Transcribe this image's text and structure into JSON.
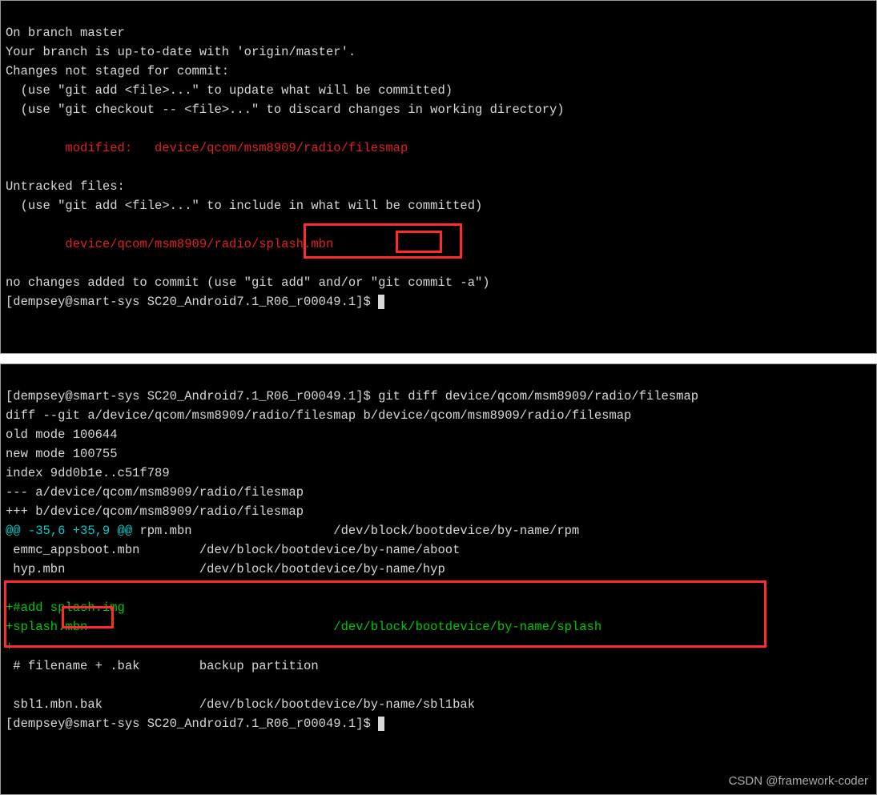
{
  "top": {
    "l1": "On branch master",
    "l2": "Your branch is up-to-date with 'origin/master'.",
    "l3": "Changes not staged for commit:",
    "l4": "  (use \"git add <file>...\" to update what will be committed)",
    "l5": "  (use \"git checkout -- <file>...\" to discard changes in working directory)",
    "l6": "",
    "l7": "        modified:   device/qcom/msm8909/radio/filesmap",
    "l8": "",
    "l9": "Untracked files:",
    "l10": "  (use \"git add <file>...\" to include in what will be committed)",
    "l11": "",
    "l12": "        device/qcom/msm8909/radio/splash.mbn",
    "l13": "",
    "l14": "no changes added to commit (use \"git add\" and/or \"git commit -a\")",
    "prompt": "[dempsey@smart-sys SC20_Android7.1_R06_r00049.1]$ "
  },
  "bottom": {
    "prompt1": "[dempsey@smart-sys SC20_Android7.1_R06_r00049.1]$ ",
    "cmd1": "git diff device/qcom/msm8909/radio/filesmap",
    "l2": "diff --git a/device/qcom/msm8909/radio/filesmap b/device/qcom/msm8909/radio/filesmap",
    "l3": "old mode 100644",
    "l4": "new mode 100755",
    "l5": "index 9dd0b1e..c51f789",
    "l6": "--- a/device/qcom/msm8909/radio/filesmap",
    "l7": "+++ b/device/qcom/msm8909/radio/filesmap",
    "hunk_cyan1": "@@ -35,6 +35,9 @@",
    "hunk_rest": " rpm.mbn                   /dev/block/bootdevice/by-name/rpm",
    "l9": " emmc_appsboot.mbn        /dev/block/bootdevice/by-name/aboot",
    "l10": " hyp.mbn                  /dev/block/bootdevice/by-name/hyp",
    "l11": " ",
    "l12": "+#add splash.img",
    "l13": "+splash.mbn                                 /dev/block/bootdevice/by-name/splash",
    "l14": "+",
    "l15": " # filename + .bak        backup partition",
    "l16": " ",
    "l17": " sbl1.mbn.bak             /dev/block/bootdevice/by-name/sbl1bak",
    "prompt2": "[dempsey@smart-sys SC20_Android7.1_R06_r00049.1]$ "
  },
  "watermark": "CSDN @framework-coder"
}
